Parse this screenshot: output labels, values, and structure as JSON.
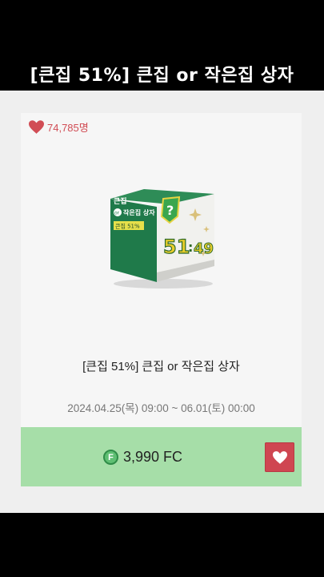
{
  "video_title": "[큰집 51%] 큰집 or 작은집 상자",
  "card": {
    "likes_count": "74,785명",
    "item_name": "[큰집 51%] 큰집 or 작은집 상자",
    "sale_period": "2024.04.25(목) 09:00 ~ 06.01(토) 00:00",
    "price": "3,990 FC",
    "coin_symbol": "F",
    "box_art": {
      "label_line1": "큰집",
      "label_or": "or",
      "label_line2": "작은집 상자",
      "label_badge": "큰집 51%",
      "ratio_left": "51",
      "ratio_sep": ":",
      "ratio_right": "49",
      "question_mark": "?"
    }
  },
  "colors": {
    "heart": "#d14d55",
    "price_bar": "#a6dea8",
    "fav_button": "#cf4651",
    "box_green": "#1f7a4a"
  },
  "icons": [
    "heart-icon",
    "coin-icon",
    "heart-button-icon"
  ]
}
